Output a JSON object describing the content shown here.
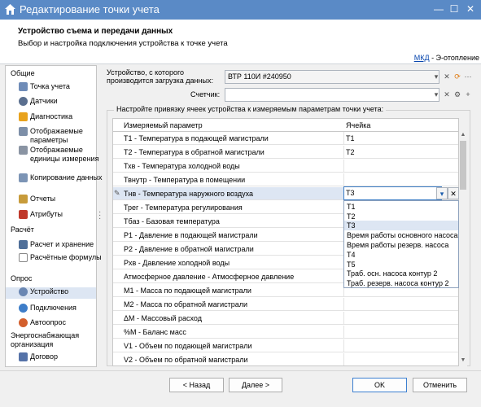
{
  "window": {
    "title": "Редактирование точки учета",
    "min_glyph": "—",
    "max_glyph": "☐",
    "close_glyph": "✕"
  },
  "header": {
    "title": "Устройство съема и передачи данных",
    "subtitle": "Выбор и настройка подключения устройства к точке учета",
    "mkd_link": "МКД",
    "mkd_suffix": " - Э-отопление"
  },
  "sidebar": {
    "sections": [
      {
        "title": "Общие",
        "items": [
          {
            "label": "Точка учета",
            "icon": "building-icon"
          },
          {
            "label": "Датчики",
            "icon": "sensor-icon"
          },
          {
            "label": "Диагностика",
            "icon": "warning-icon"
          },
          {
            "label": "Отображаемые параметры",
            "icon": "params-icon"
          },
          {
            "label": "Отображаемые единицы измерения",
            "icon": "units-icon"
          },
          {
            "label": "Копирование данных",
            "icon": "copy-icon"
          },
          {
            "label": "Отчеты",
            "icon": "report-icon"
          },
          {
            "label": "Атрибуты",
            "icon": "attribute-icon"
          }
        ]
      },
      {
        "title": "Расчёт",
        "items": [
          {
            "label": "Расчет и хранение",
            "icon": "calc-icon"
          },
          {
            "label": "Расчётные формулы",
            "icon": "formula-icon"
          }
        ]
      },
      {
        "title": "Опрос",
        "items": [
          {
            "label": "Устройство",
            "icon": "device-icon"
          },
          {
            "label": "Подключения",
            "icon": "globe-icon"
          },
          {
            "label": "Автоопрос",
            "icon": "autopoll-icon"
          }
        ]
      },
      {
        "title": "Энергоснабжающая организация",
        "items": [
          {
            "label": "Договор",
            "icon": "contract-icon"
          }
        ]
      }
    ],
    "selected": "Устройство"
  },
  "device": {
    "label": "Устройство, с которого производится загрузка данных:",
    "value": "ВТР 110И #240950",
    "counter_label": "Счетчик:",
    "counter_value": ""
  },
  "mapping": {
    "group_title": "Настройте привязку ячеек устройства к измеряемым параметрам точки учета:",
    "col_param": "Измеряемый параметр",
    "col_cell": "Ячейка",
    "rows": [
      {
        "param": "T1 - Температура в подающей магистрали",
        "cell": "T1"
      },
      {
        "param": "T2 - Температура в обратной магистрали",
        "cell": "T2"
      },
      {
        "param": "Тхв - Температура холодной воды",
        "cell": ""
      },
      {
        "param": "Твнутр - Температура в помещении",
        "cell": ""
      },
      {
        "param": "Тнв - Температура наружного воздуха",
        "cell": "T3"
      },
      {
        "param": "Трег - Температура регулирования",
        "cell": ""
      },
      {
        "param": "Тбаз - Базовая температура",
        "cell": ""
      },
      {
        "param": "P1 - Давление в подающей магистрали",
        "cell": ""
      },
      {
        "param": "P2 - Давление в обратной магистрали",
        "cell": ""
      },
      {
        "param": "Pхв - Давление холодной воды",
        "cell": ""
      },
      {
        "param": "Атмосферное давление - Атмосферное давление",
        "cell": ""
      },
      {
        "param": "M1 - Масса по подающей магистрали",
        "cell": ""
      },
      {
        "param": "M2 - Масса по обратной магистрали",
        "cell": ""
      },
      {
        "param": "ΔM - Массовый расход",
        "cell": ""
      },
      {
        "param": "%M - Баланс масс",
        "cell": ""
      },
      {
        "param": "V1 - Объем по подающей магистрали",
        "cell": ""
      },
      {
        "param": "V2 - Объем по обратной магистрали",
        "cell": ""
      }
    ],
    "editing_row": 4,
    "edit_value": "T3",
    "dropdown_options": [
      "T1",
      "T2",
      "T3",
      "Время работы основного насоса",
      "Время работы резерв. насоса",
      "T4",
      "T5",
      "Траб. осн. насоса контур 2",
      "Траб. резерв. насоса контур 2"
    ],
    "dropdown_selected": "T3"
  },
  "footer": {
    "back": "< Назад",
    "next": "Далее >",
    "ok": "OK",
    "cancel": "Отменить"
  },
  "colors": {
    "titlebar": "#5a8ac6",
    "selection": "#dde6f3",
    "link": "#0645ad"
  }
}
